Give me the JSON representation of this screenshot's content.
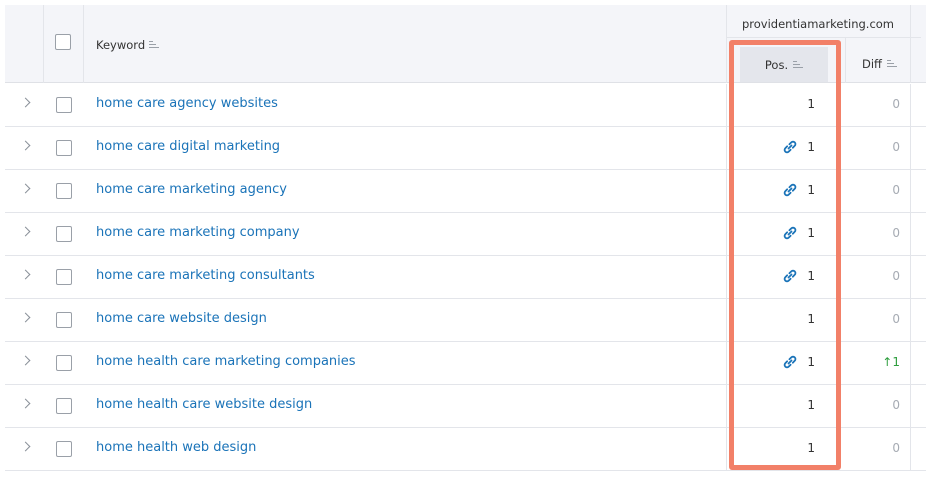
{
  "header": {
    "domain": "providentiamarketing.com",
    "keyword_label": "Keyword",
    "pos_label": "Pos.",
    "diff_label": "Diff"
  },
  "rows": [
    {
      "keyword": "home care agency websites",
      "has_link": false,
      "pos": "1",
      "diff": "0",
      "diff_up": false
    },
    {
      "keyword": "home care digital marketing",
      "has_link": true,
      "pos": "1",
      "diff": "0",
      "diff_up": false
    },
    {
      "keyword": "home care marketing agency",
      "has_link": true,
      "pos": "1",
      "diff": "0",
      "diff_up": false
    },
    {
      "keyword": "home care marketing company",
      "has_link": true,
      "pos": "1",
      "diff": "0",
      "diff_up": false
    },
    {
      "keyword": "home care marketing consultants",
      "has_link": true,
      "pos": "1",
      "diff": "0",
      "diff_up": false
    },
    {
      "keyword": "home care website design",
      "has_link": false,
      "pos": "1",
      "diff": "0",
      "diff_up": false
    },
    {
      "keyword": "home health care marketing companies",
      "has_link": true,
      "pos": "1",
      "diff": "↑1",
      "diff_up": true
    },
    {
      "keyword": "home health care website design",
      "has_link": false,
      "pos": "1",
      "diff": "0",
      "diff_up": false
    },
    {
      "keyword": "home health web design",
      "has_link": false,
      "pos": "1",
      "diff": "0",
      "diff_up": false
    }
  ],
  "colors": {
    "keyword_link": "#1a73b8",
    "highlight": "#f28068",
    "diff_up": "#2e9e3e"
  }
}
